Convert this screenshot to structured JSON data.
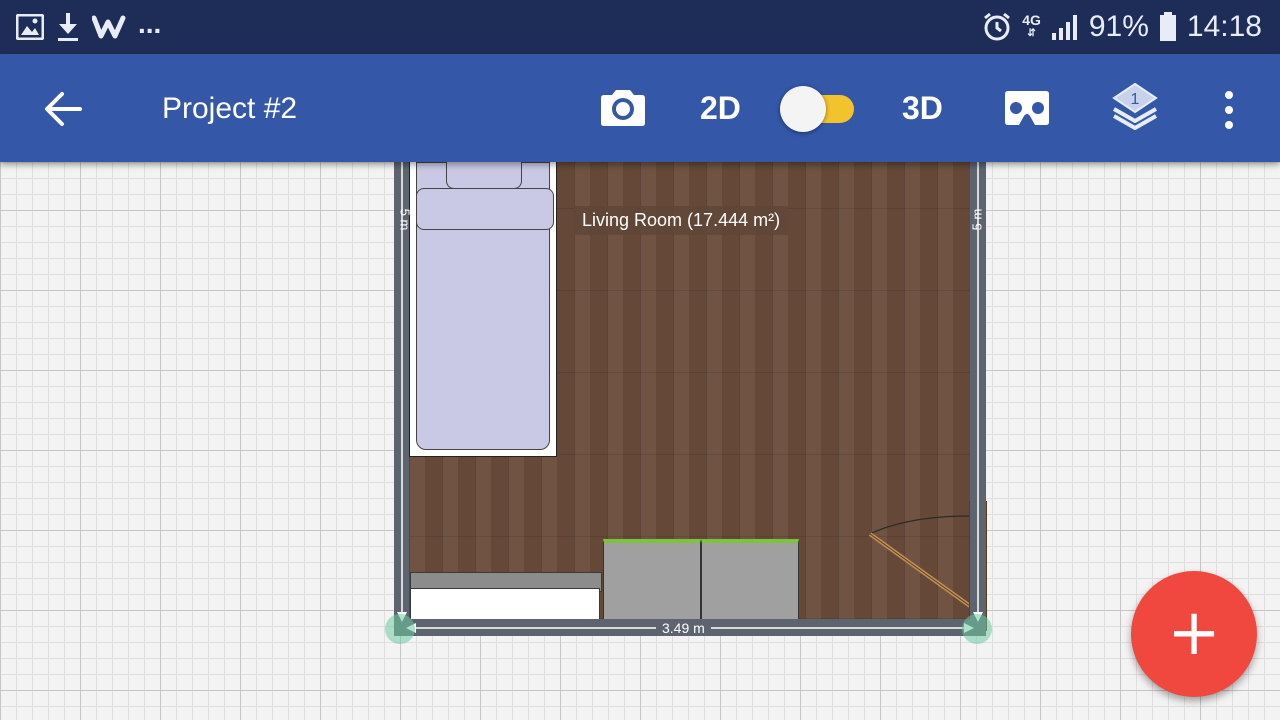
{
  "status_bar": {
    "overflow": "...",
    "network": "4G",
    "battery": "91%",
    "time": "14:18",
    "icons": [
      "gallery-icon",
      "download-icon",
      "w-app-icon",
      "alarm-icon",
      "signal-icon",
      "battery-icon"
    ]
  },
  "toolbar": {
    "title": "Project #2",
    "mode_2d": "2D",
    "mode_3d": "3D",
    "layers_count": "1",
    "view_mode_on": "2D",
    "icons": [
      "back-arrow-icon",
      "camera-icon",
      "vr-headset-icon",
      "layers-icon",
      "more-vert-icon"
    ]
  },
  "plan": {
    "room_label": "Living Room (17.444 m²)",
    "dim_left": "5 m",
    "dim_right": "5 m",
    "dim_bottom": "3.49 m"
  },
  "fab": {
    "label": "+",
    "icon": "add-icon"
  },
  "colors": {
    "status_bar": "#1e2d57",
    "toolbar": "#3457a8",
    "toggle_track": "#f2c32a",
    "fab": "#f0473f",
    "wall": "#5d6470",
    "floor": "#6a4c3a"
  }
}
